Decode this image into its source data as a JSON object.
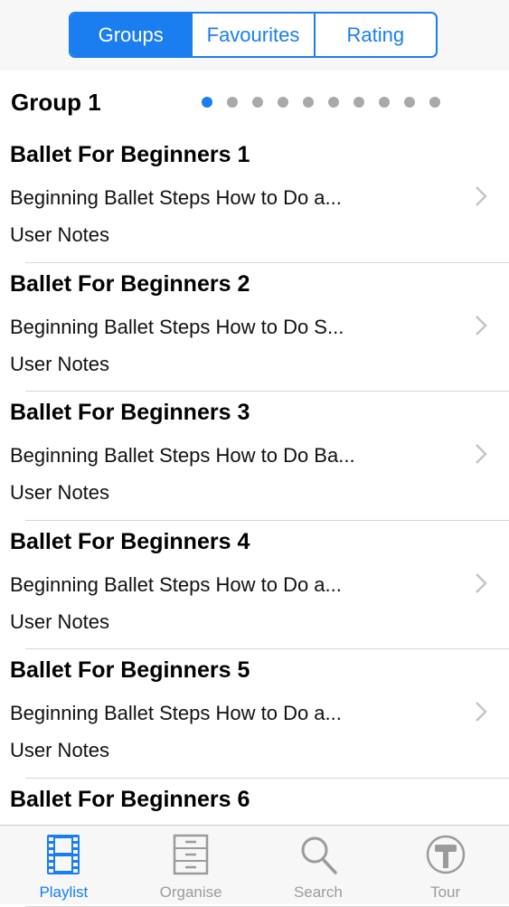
{
  "segments": {
    "groups": "Groups",
    "favourites": "Favourites",
    "rating": "Rating"
  },
  "group": {
    "title": "Group 1",
    "page_count": 10,
    "active_page": 1
  },
  "items": [
    {
      "title": "Ballet For Beginners 1",
      "subtitle": "Beginning Ballet Steps  How to Do a...",
      "notes": "User Notes"
    },
    {
      "title": "Ballet For Beginners 2",
      "subtitle": "Beginning Ballet Steps  How to Do S...",
      "notes": "User Notes"
    },
    {
      "title": "Ballet For Beginners 3",
      "subtitle": "Beginning Ballet Steps  How to Do Ba...",
      "notes": "User Notes"
    },
    {
      "title": "Ballet For Beginners 4",
      "subtitle": "Beginning Ballet Steps  How to Do a...",
      "notes": "User Notes"
    },
    {
      "title": "Ballet For Beginners 5",
      "subtitle": "Beginning Ballet Steps  How to Do a...",
      "notes": "User Notes"
    },
    {
      "title": "Ballet For Beginners 6",
      "subtitle": "",
      "notes": ""
    }
  ],
  "tabs": {
    "playlist": {
      "label": "Playlist",
      "icon": "film-strip-icon"
    },
    "organise": {
      "label": "Organise",
      "icon": "file-cabinet-icon"
    },
    "search": {
      "label": "Search",
      "icon": "magnifier-icon"
    },
    "tour": {
      "label": "Tour",
      "icon": "hammer-icon"
    }
  },
  "colors": {
    "accent": "#1a7ef0",
    "inactive": "#9b9b9b"
  }
}
